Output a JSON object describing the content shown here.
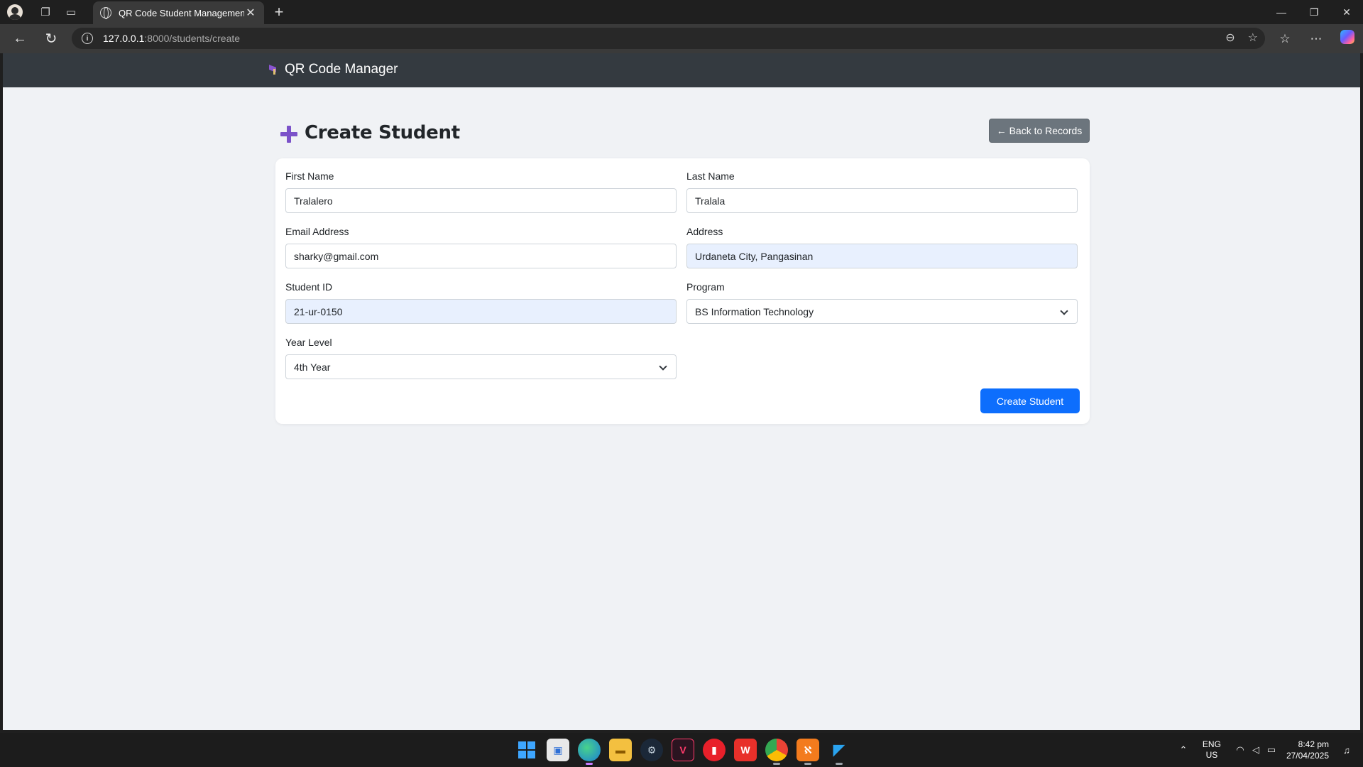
{
  "browser": {
    "tab_title": "QR Code Student Management",
    "new_tab_symbol": "+",
    "url_host": "127.0.0.1",
    "url_path": ":8000/students/create"
  },
  "app": {
    "brand": "QR Code Manager"
  },
  "page": {
    "title": "Create Student",
    "back_button": "← Back to Records",
    "submit_button": "Create Student"
  },
  "form": {
    "first_name": {
      "label": "First Name",
      "value": "Tralalero"
    },
    "last_name": {
      "label": "Last Name",
      "value": "Tralala"
    },
    "email": {
      "label": "Email Address",
      "value": "sharky@gmail.com"
    },
    "address": {
      "label": "Address",
      "value": "Urdaneta City,  Pangasinan"
    },
    "student_id": {
      "label": "Student ID",
      "value": "21-ur-0150"
    },
    "program": {
      "label": "Program",
      "value": "BS Information Technology"
    },
    "year_level": {
      "label": "Year Level",
      "value": "4th Year"
    }
  },
  "taskbar": {
    "lang_top": "ENG",
    "lang_bottom": "US",
    "time": "8:42 pm",
    "date": "27/04/2025"
  },
  "colors": {
    "accent": "#0d6efd",
    "navbar": "#343a40",
    "back_button": "#6c757d",
    "plus_icon": "#7b52c9",
    "autofill": "#e8f0fe"
  }
}
